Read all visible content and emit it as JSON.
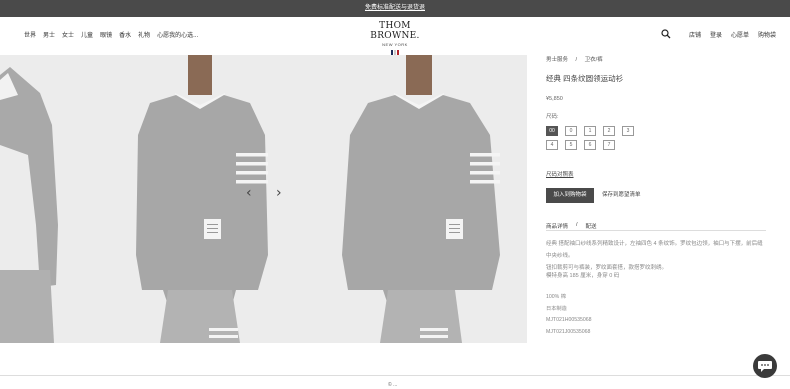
{
  "promo": {
    "text": "免费标准配送与退货退"
  },
  "header": {
    "nav_left": [
      "世界",
      "男士",
      "女士",
      "儿童",
      "眼镜",
      "香水",
      "礼物",
      "心愿我的心选..."
    ],
    "logo": {
      "main": "THOM BROWNE.",
      "sub": "NEW YORK"
    },
    "nav_right": [
      "店铺",
      "登录",
      "心愿单",
      "购物袋"
    ],
    "search_icon": "search-icon",
    "tricolor": [
      "#1b2a57",
      "#ffffff",
      "#b3262d"
    ]
  },
  "gallery": {
    "prev_arrow": "‹",
    "next_arrow": "›"
  },
  "product": {
    "breadcrumb": [
      "男士服务",
      "/",
      "卫衣/裤"
    ],
    "title": "经典 四条纹圆领运动衫",
    "price": "¥5,850",
    "size_label": "尺码:",
    "sizes": [
      "00",
      "0",
      "1",
      "2",
      "3",
      "4",
      "5",
      "6",
      "7"
    ],
    "selected_size": "00",
    "size_guide": "尺码对照表",
    "add_to_bag": "加入到购物袋",
    "save_wishlist": "保存到愿望清单",
    "tabs": [
      "商品详情",
      "/",
      "配送"
    ],
    "description": "经典 搭配袖口纱线系列精致设计，左袖四色 4 条纹饰。罗纹包边领，袖口与下摆，前后缝中央纱线。",
    "description_2": "钮扣裁剪可与裤装，罗纹面套搭，款搭罗纹刺绣。",
    "model_info": "模特身高 185 厘米，身穿 0 码",
    "specs": [
      "100% 棉",
      "日本制造",
      "MJT021H00535068",
      "MJT021J00535068"
    ]
  },
  "footer": {
    "text": "© ..."
  }
}
